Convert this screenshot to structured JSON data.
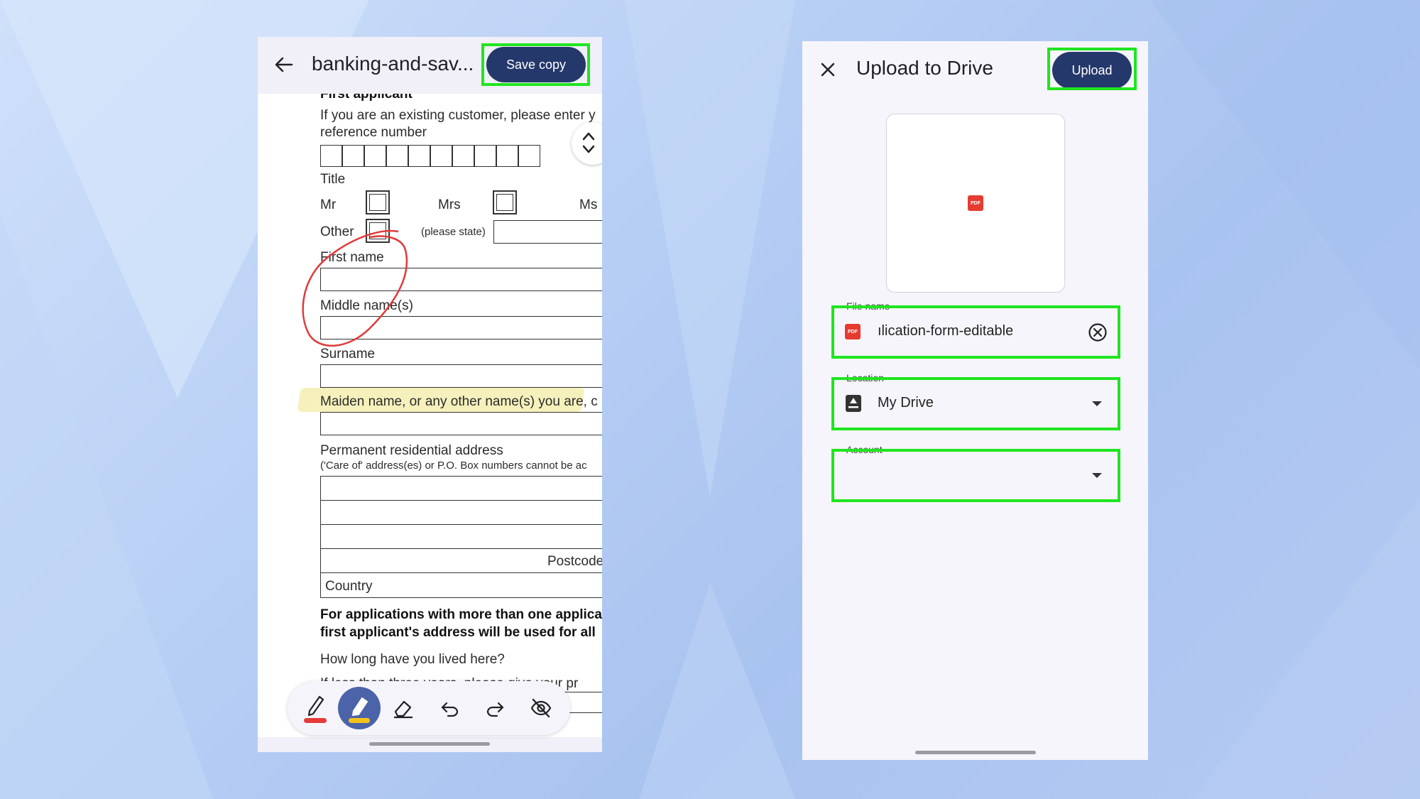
{
  "left_screen": {
    "header": {
      "doc_title": "banking-and-sav...",
      "save_label": "Save copy"
    },
    "form": {
      "section_heading": "First applicant",
      "existing_customer_line1": "If you are an existing customer, please enter y",
      "existing_customer_line2": "reference number",
      "title_label": "Title",
      "title_mr": "Mr",
      "title_mrs": "Mrs",
      "title_ms": "Ms",
      "title_other": "Other",
      "please_state": "(please state)",
      "first_name": "First name",
      "middle_names": "Middle name(s)",
      "surname": "Surname",
      "maiden_name": "Maiden name, or any other name(s) you are, c",
      "address_label": "Permanent residential address",
      "address_note": "('Care of' address(es) or P.O. Box numbers cannot be ac",
      "postcode": "Postcode",
      "country": "Country",
      "multi_applicant_line1": "For applications with more than one applica",
      "multi_applicant_line2": "first applicant's address will be used for all",
      "how_long": "How long have you lived here?",
      "cut_line": "If less than three years, please give your pr"
    },
    "annotations": {
      "circle_color": "#e0393a",
      "highlight_color": "#f5efb0"
    },
    "toolbar": {
      "tools": [
        "pen-icon",
        "highlighter-icon",
        "eraser-icon",
        "undo-icon",
        "redo-icon",
        "hide-annotations-icon"
      ],
      "pen_color": "#e53b3b",
      "highlighter_color": "#f5c21b"
    }
  },
  "right_screen": {
    "title": "Upload to Drive",
    "upload_label": "Upload",
    "preview_badge": "PDF",
    "file_name": {
      "label": "File name",
      "value": "ılication-form-editable_copy.p"
    },
    "location": {
      "label": "Location",
      "value": "My Drive"
    },
    "account": {
      "label": "Account",
      "value": ""
    }
  },
  "colors": {
    "accent_button": "#24386b",
    "highlight_box": "#1fe51f",
    "pdf_red": "#e53b30"
  }
}
